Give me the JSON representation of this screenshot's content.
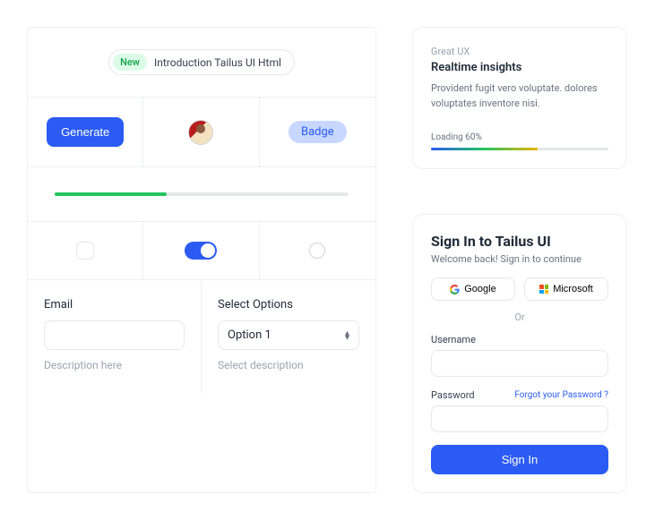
{
  "announce": {
    "pill": "New",
    "text": "Introduction Tailus UI Html"
  },
  "components": {
    "generate_label": "Generate",
    "badge_label": "Badge"
  },
  "form": {
    "email": {
      "label": "Email",
      "description": "Description here"
    },
    "select": {
      "label": "Select Options",
      "value": "Option 1",
      "description": "Select description"
    }
  },
  "insights": {
    "eyebrow": "Great UX",
    "title": "Realtime insights",
    "body": "Provident fugit vero voluptate. dolores voluptates inventore nisi.",
    "loading_label": "Loading 60%",
    "loading_percent": 60
  },
  "signin": {
    "title": "Sign In to Tailus UI",
    "subtitle": "Welcome back! Sign in to continue",
    "google": "Google",
    "microsoft": "Microsoft",
    "or": "Or",
    "username_label": "Username",
    "password_label": "Password",
    "forgot": "Forgot your Password ?",
    "submit": "Sign In"
  }
}
